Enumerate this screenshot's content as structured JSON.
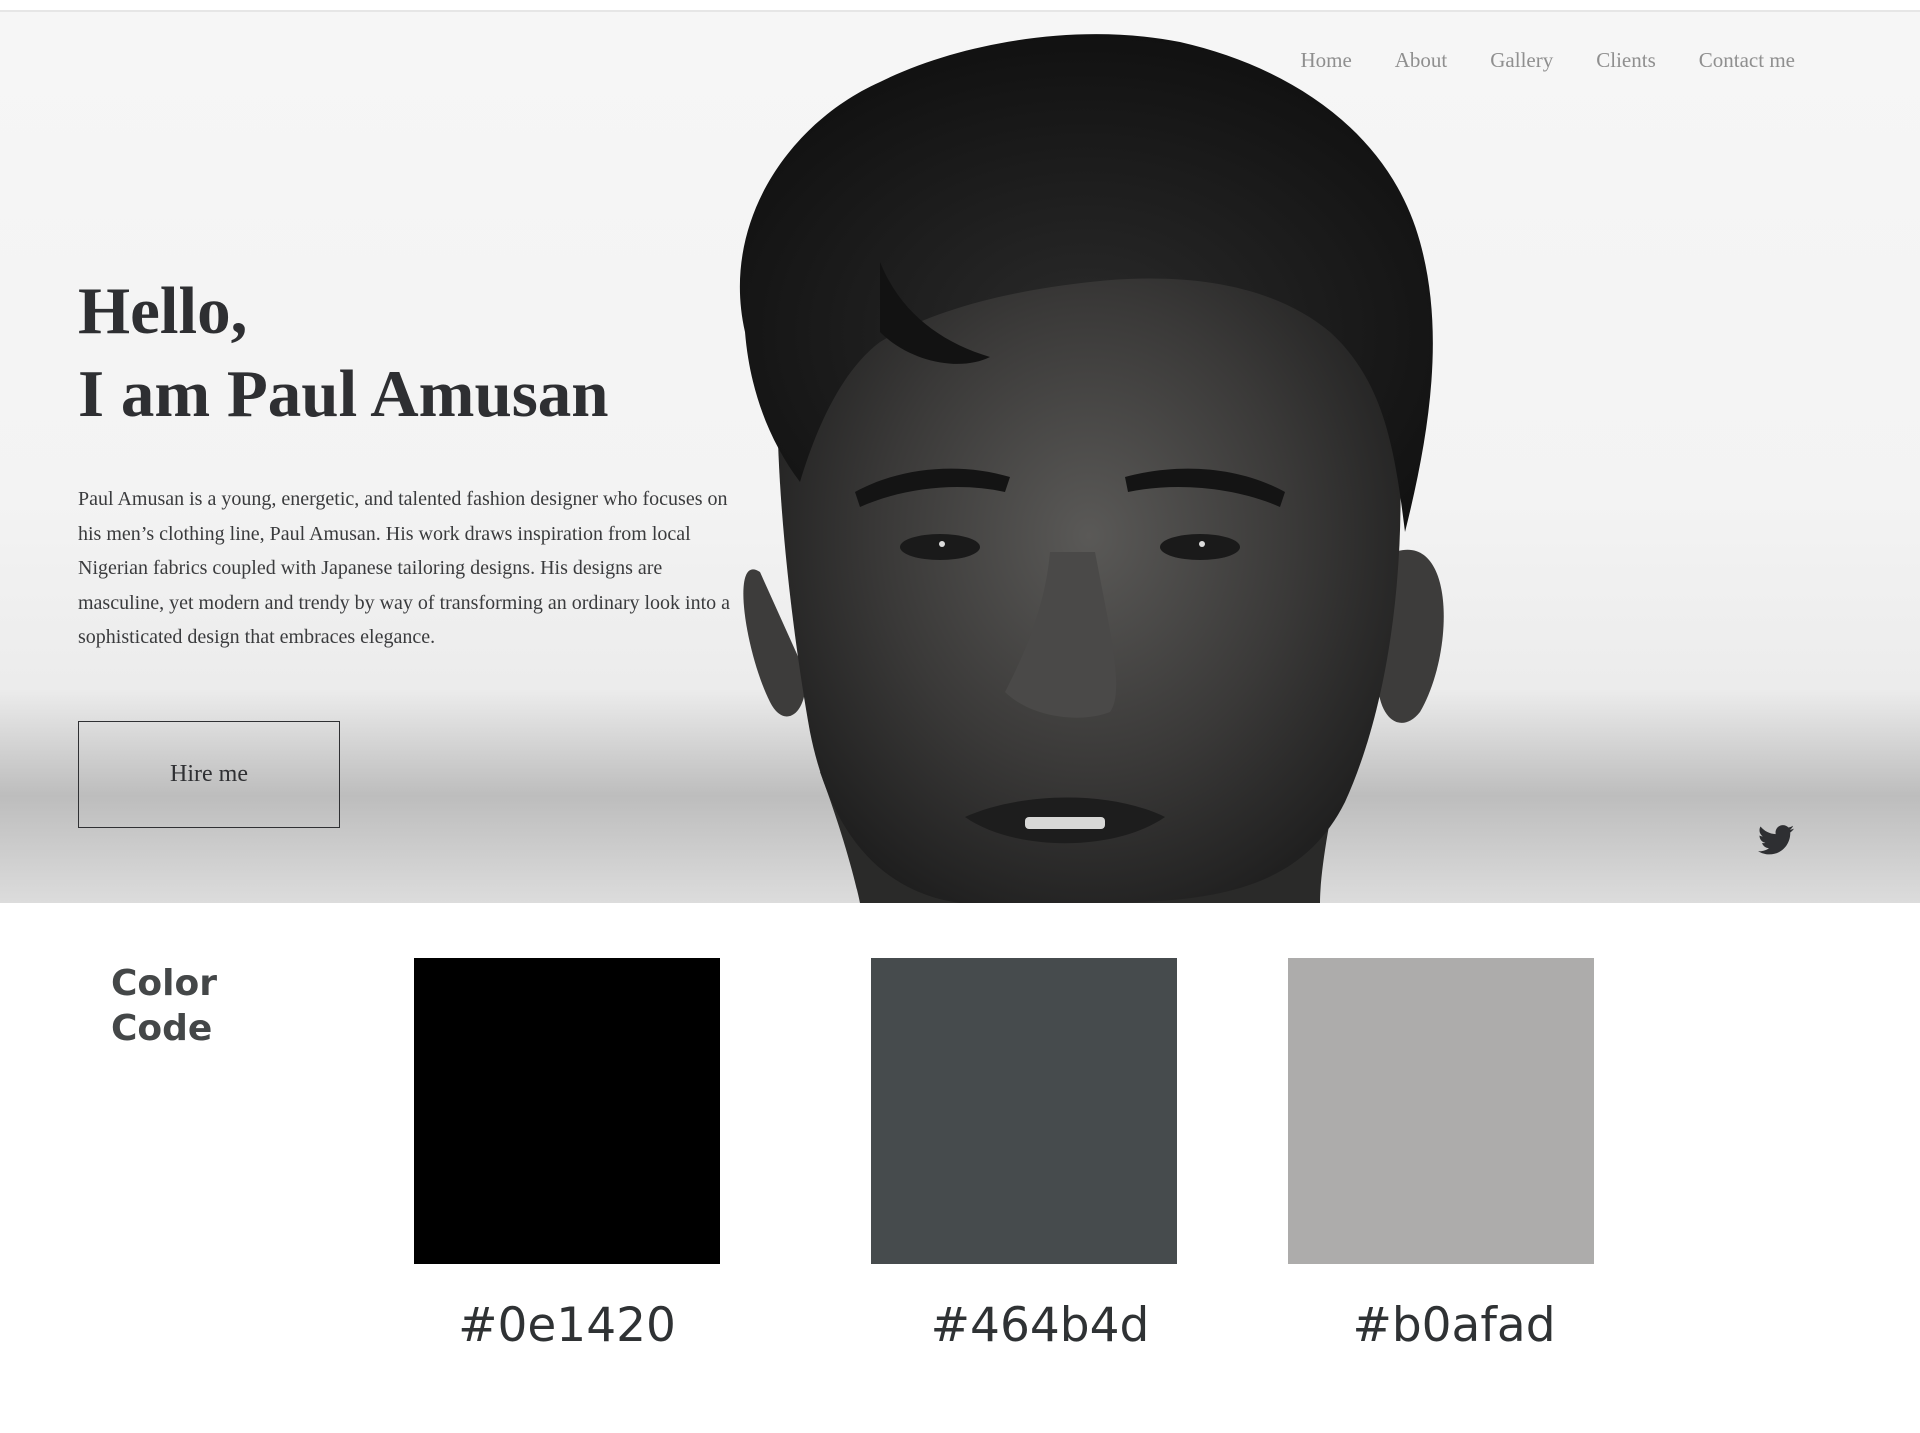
{
  "nav": {
    "items": [
      {
        "label": "Home"
      },
      {
        "label": "About"
      },
      {
        "label": "Gallery"
      },
      {
        "label": "Clients"
      },
      {
        "label": "Contact me"
      }
    ]
  },
  "hero": {
    "heading_line1": "Hello,",
    "heading_line2": "I am Paul Amusan",
    "bio": "Paul Amusan is a young, energetic, and talented fashion designer who focuses on his men’s clothing line, Paul Amusan. His work draws inspiration from local Nigerian fabrics coupled with Japanese tailoring designs. His designs are masculine, yet modern and trendy by way of transforming an ordinary look into a sophisticated design that embraces elegance.",
    "cta_label": "Hire me",
    "social_icon": "twitter-icon"
  },
  "palette": {
    "label_line1": "Color",
    "label_line2": "Code",
    "swatches": [
      {
        "label": "#0e1420",
        "fill": "#000000"
      },
      {
        "label": "#464b4d",
        "fill": "#464b4d"
      },
      {
        "label": "#b0afad",
        "fill": "#adacab"
      }
    ]
  },
  "colors": {
    "nav_text": "#8f8f8f",
    "heading": "#2e2f32",
    "body_text": "#3a3b3d"
  }
}
